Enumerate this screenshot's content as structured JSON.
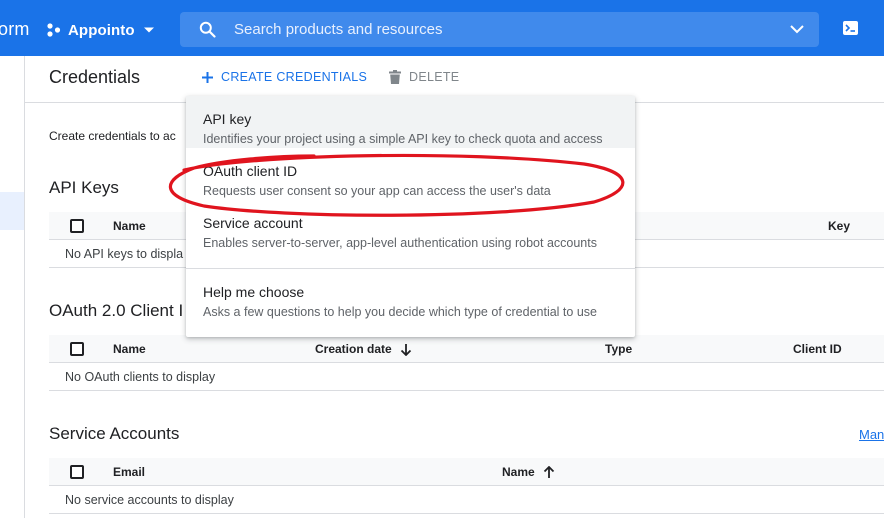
{
  "topbar": {
    "brand_fragment": "orm",
    "project_name": "Appointo",
    "search_placeholder": "Search products and resources"
  },
  "header": {
    "title": "Credentials",
    "create_label": "CREATE CREDENTIALS",
    "delete_label": "DELETE"
  },
  "intro_text": "Create credentials to ac",
  "api_keys": {
    "title": "API Keys",
    "columns": [
      "Name",
      "Key"
    ],
    "empty": "No API keys to displa"
  },
  "oauth": {
    "title": "OAuth 2.0 Client I",
    "columns": [
      "Name",
      "Creation date",
      "Type",
      "Client ID"
    ],
    "empty": "No OAuth clients to display"
  },
  "service_accounts": {
    "title": "Service Accounts",
    "columns": [
      "Email",
      "Name"
    ],
    "empty": "No service accounts to display",
    "manage_link": "Man"
  },
  "menu": {
    "items": [
      {
        "title": "API key",
        "description": "Identifies your project using a simple API key to check quota and access"
      },
      {
        "title": "OAuth client ID",
        "description": "Requests user consent so your app can access the user's data"
      },
      {
        "title": "Service account",
        "description": "Enables server-to-server, app-level authentication using robot accounts"
      },
      {
        "title": "Help me choose",
        "description": "Asks a few questions to help you decide which type of credential to use"
      }
    ]
  },
  "colors": {
    "topbar": "#1a73e8",
    "link": "#1a73e8",
    "annotation": "#e0141e"
  }
}
